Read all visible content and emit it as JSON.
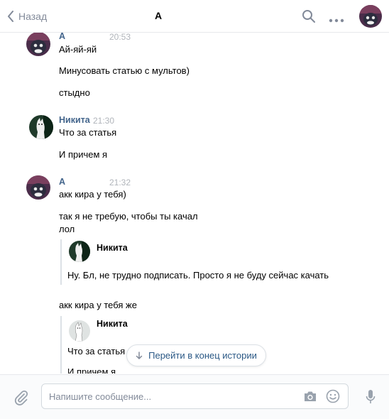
{
  "header": {
    "back_label": "Назад",
    "title": "А"
  },
  "messages": [
    {
      "name": "А",
      "time": "20:53",
      "lines": [
        "Ай-яй-яй",
        "Минусовать статью с мультов)",
        "стыдно"
      ]
    },
    {
      "name": "Никита",
      "time": "21:30",
      "lines": [
        "Что за статья",
        "И причем я"
      ]
    },
    {
      "name": "А",
      "time": "21:32",
      "lines": [
        "акк кира у тебя)",
        "так я не требую, чтобы ты качал",
        "лол",
        "акк кира у тебя же"
      ]
    }
  ],
  "forwards": [
    {
      "name": "Никита",
      "text": "Ну. Бл, не трудно подписать. Просто я не буду сейчас качать"
    },
    {
      "name": "Никита",
      "lines": [
        "Что за статья",
        "И причем я"
      ]
    }
  ],
  "jump_button": "Перейти в конец истории",
  "composer": {
    "placeholder": "Напишите сообщение..."
  },
  "icons": {
    "back": "chevron-left-icon",
    "search": "search-icon",
    "more": "more-dots-icon",
    "attach": "paperclip-icon",
    "camera": "camera-icon",
    "emoji": "smile-icon",
    "voice": "microphone-icon",
    "jump": "arrow-down-icon"
  },
  "colors": {
    "link": "#42648b",
    "accent": "#2a5885",
    "muted": "#828a99",
    "time": "#b0b4ba"
  }
}
